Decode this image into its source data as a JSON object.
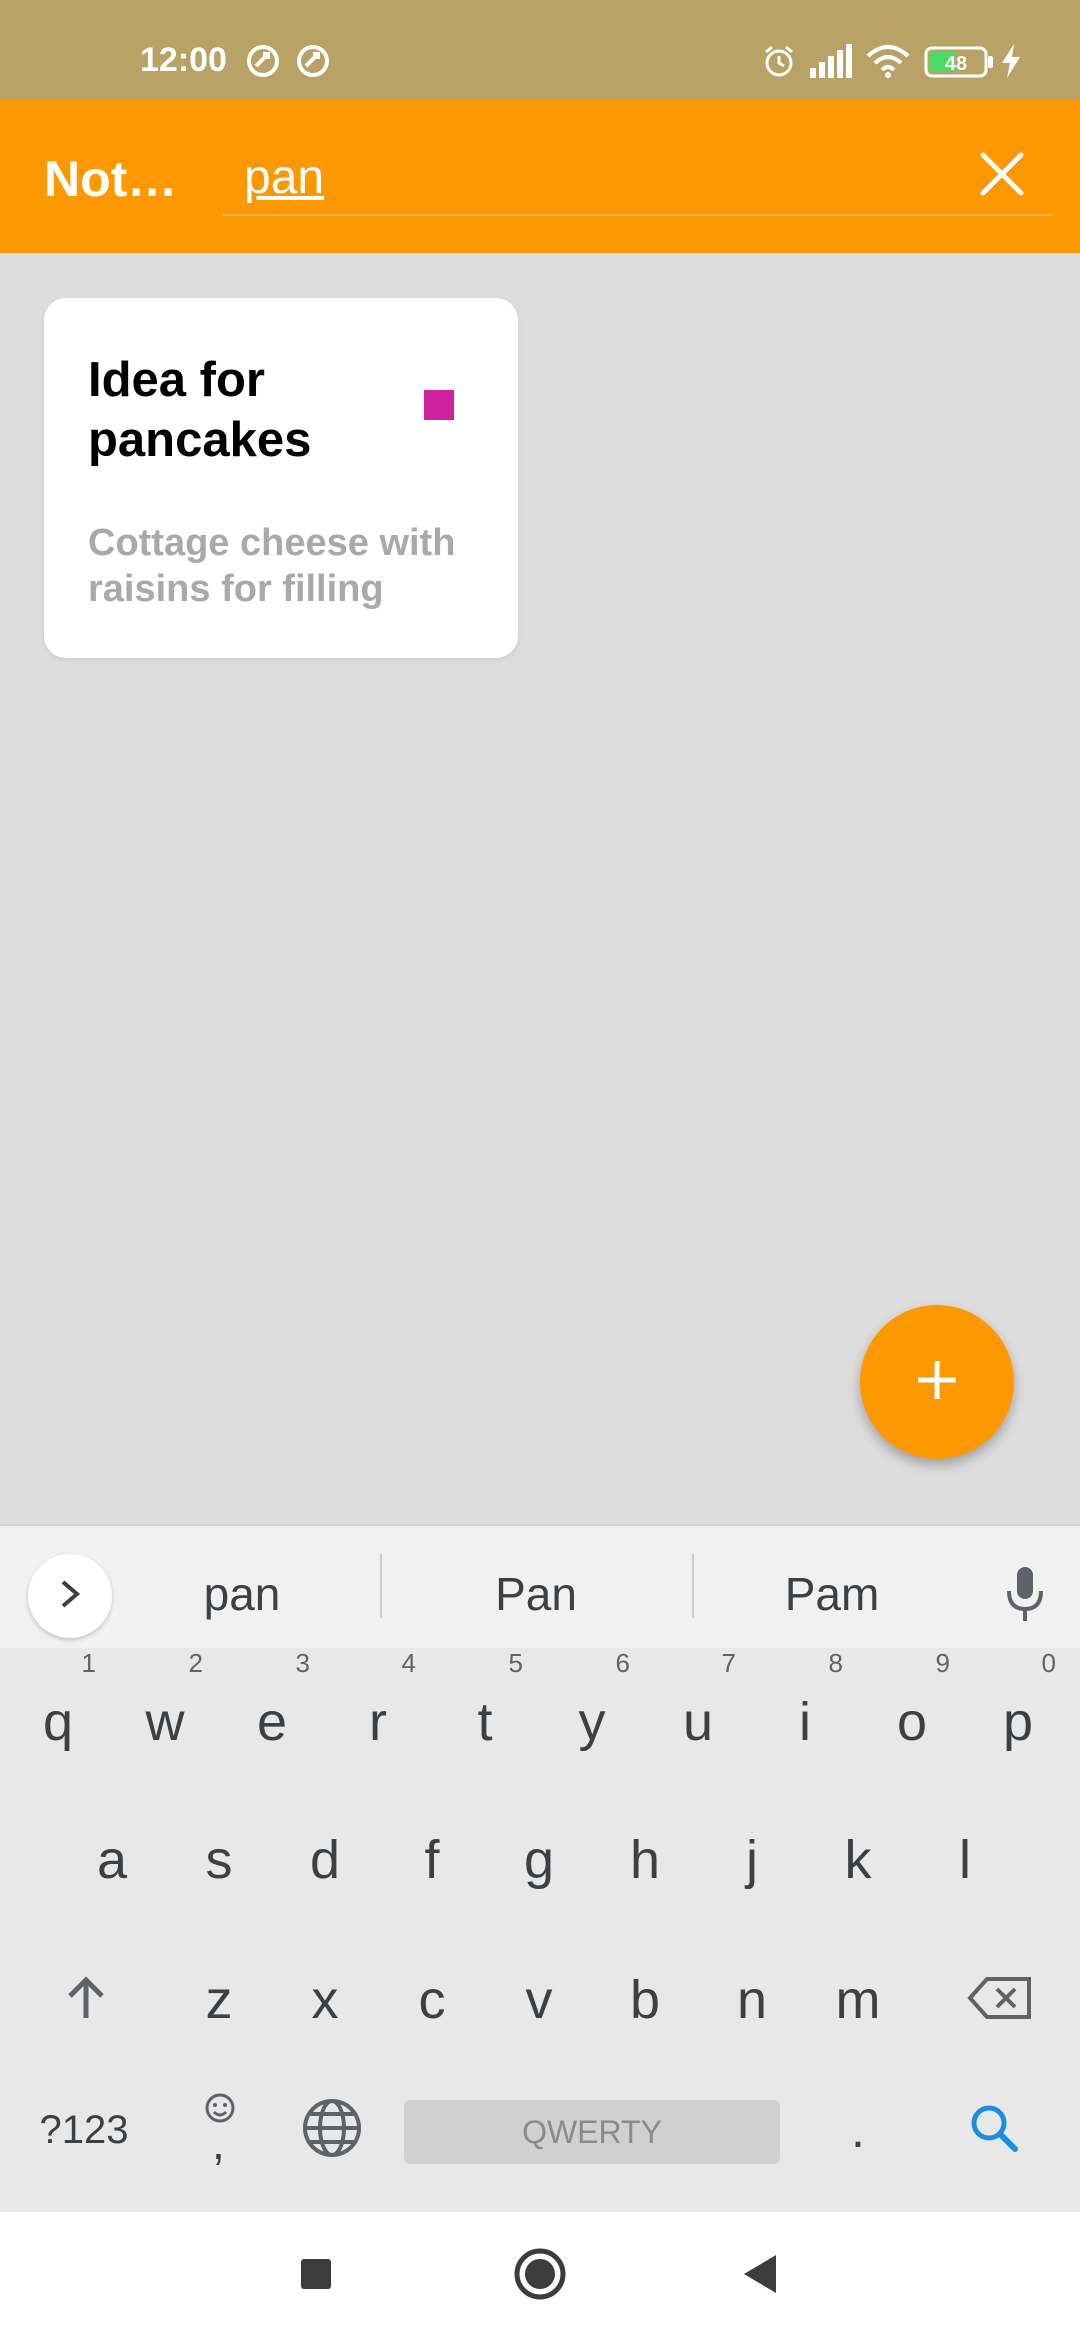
{
  "status_bar": {
    "time": "12:00",
    "battery": "48",
    "icons": [
      "sync-icon",
      "sync-icon",
      "alarm-icon",
      "signal-icon",
      "wifi-icon",
      "battery-icon",
      "charging-icon"
    ]
  },
  "app_bar": {
    "title": "Not…",
    "search_value": "pan",
    "close_icon": "close-icon"
  },
  "notes": [
    {
      "title": "Idea for pancakes",
      "body": "Cottage cheese with raisins for filling",
      "color": "#d0219c"
    }
  ],
  "fab": {
    "icon": "plus-icon",
    "color": "#fe9800"
  },
  "keyboard": {
    "suggestions": [
      "pan",
      "Pan",
      "Pam"
    ],
    "row1": [
      {
        "key": "q",
        "hint": "1"
      },
      {
        "key": "w",
        "hint": "2"
      },
      {
        "key": "e",
        "hint": "3"
      },
      {
        "key": "r",
        "hint": "4"
      },
      {
        "key": "t",
        "hint": "5"
      },
      {
        "key": "y",
        "hint": "6"
      },
      {
        "key": "u",
        "hint": "7"
      },
      {
        "key": "i",
        "hint": "8"
      },
      {
        "key": "o",
        "hint": "9"
      },
      {
        "key": "p",
        "hint": "0"
      }
    ],
    "row2": [
      "a",
      "s",
      "d",
      "f",
      "g",
      "h",
      "j",
      "k",
      "l"
    ],
    "row3": [
      "z",
      "x",
      "c",
      "v",
      "b",
      "n",
      "m"
    ],
    "symbols_label": "?123",
    "comma_label": ",",
    "space_label": "QWERTY",
    "period_label": ".",
    "accent_color": "#1a8fe0"
  },
  "colors": {
    "status_bar": "#b9a265",
    "app_bar": "#fe9800",
    "background": "#dedddd"
  }
}
